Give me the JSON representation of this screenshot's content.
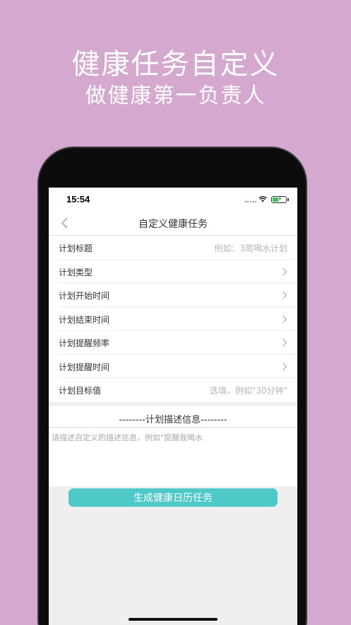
{
  "promo": {
    "title": "健康任务自定义",
    "subtitle": "做健康第一负责人"
  },
  "status_bar": {
    "time": "15:54",
    "icons": [
      "cellular-dots-icon",
      "wifi-icon",
      "battery-charging-icon"
    ]
  },
  "nav": {
    "back_icon": "chevron-left-icon",
    "title": "自定义健康任务"
  },
  "form": {
    "rows": [
      {
        "label": "计划标题",
        "placeholder": "例如：3周喝水计划",
        "type": "input"
      },
      {
        "label": "计划类型",
        "type": "select",
        "icon": "chevron-right-icon"
      },
      {
        "label": "计划开始时间",
        "type": "select",
        "icon": "chevron-right-icon"
      },
      {
        "label": "计划结束时间",
        "type": "select",
        "icon": "chevron-right-icon"
      },
      {
        "label": "计划提醒频率",
        "type": "select",
        "icon": "chevron-right-icon"
      },
      {
        "label": "计划提醒时间",
        "type": "select",
        "icon": "chevron-right-icon"
      },
      {
        "label": "计划目标值",
        "placeholder": "选填，例如\"30分钟\"",
        "type": "input"
      }
    ]
  },
  "description": {
    "header": "--------计划描述信息--------",
    "placeholder": "请描述自定义的描述信息，例如\"提醒我喝水"
  },
  "generate_button": {
    "label": "生成健康日历任务"
  },
  "colors": {
    "background": "#d4a8cf",
    "accent": "#4fc8c8"
  }
}
